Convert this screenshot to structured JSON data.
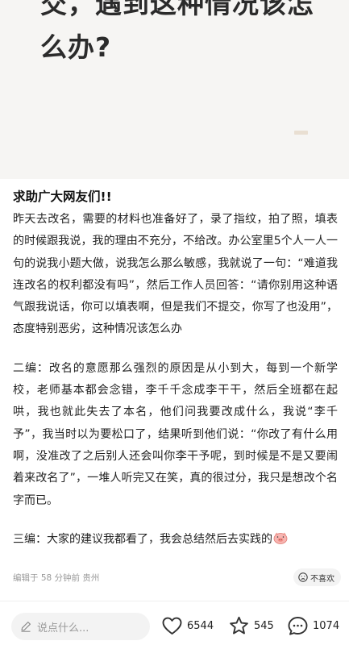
{
  "cover": {
    "title": "交，遇到这种情况该怎么办?"
  },
  "post": {
    "title": "求助广大网友们!!",
    "paragraphs": [
      "昨天去改名，需要的材料也准备好了，录了指纹，拍了照，填表的时候跟我说，我的理由不充分，不给改。办公室里5个人一人一句的说我小题大做，说我怎么那么敏感，我就说了一句：“难道我连改名的权利都没有吗”，然后工作人员回答：“请你别用这种语气跟我说话，你可以填表啊，但是我们不提交，你写了也没用”，态度特别恶劣，这种情况该怎么办",
      "二编：改名的意愿那么强烈的原因是从小到大，每到一个新学校，老师基本都会念错，李千千念成李干干，然后全班都在起哄，我也就此失去了本名，他们问我要改成什么，我说“李千予”，我当时以为要松口了，结果听到他们说：“你改了有什么用啊，没准改了之后别人还会叫你李干予呢，到时候是不是又要闹着来改名了”，一堆人听完又在笑，真的很过分，我只是想改个名字而已。",
      "三编：大家的建议我都看了，我会总结然后去实践的"
    ],
    "emoji_icon": "pig-face-emoji"
  },
  "meta": {
    "edited": "编辑于 58 分钟前 贵州",
    "dislike_label": "不喜欢"
  },
  "bottom_bar": {
    "comment_placeholder": "说点什么...",
    "likes": "6544",
    "collects": "545",
    "comments": "1074"
  },
  "colors": {
    "cover_bg": "#f6f5f3",
    "text": "#222222",
    "muted": "#999999",
    "input_bg": "#f3f3f3"
  }
}
